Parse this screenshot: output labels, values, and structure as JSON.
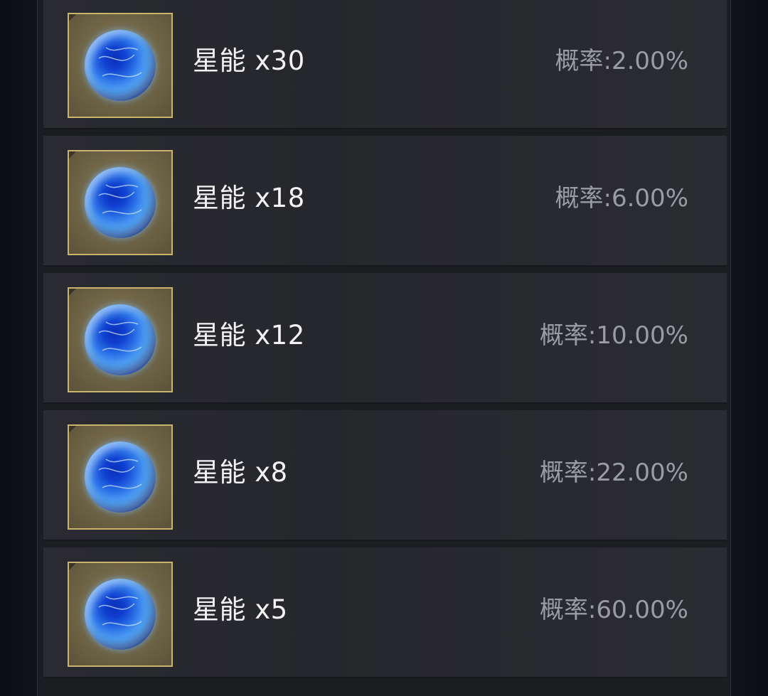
{
  "rewards": [
    {
      "name": "星能 x30",
      "probability": "概率:2.00%",
      "icon": "star-energy-orb-icon"
    },
    {
      "name": "星能 x18",
      "probability": "概率:6.00%",
      "icon": "star-energy-orb-icon"
    },
    {
      "name": "星能 x12",
      "probability": "概率:10.00%",
      "icon": "star-energy-orb-icon"
    },
    {
      "name": "星能 x8",
      "probability": "概率:22.00%",
      "icon": "star-energy-orb-icon"
    },
    {
      "name": "星能 x5",
      "probability": "概率:60.00%",
      "icon": "star-energy-orb-icon"
    }
  ],
  "colors": {
    "row_background": "#2a2b30",
    "icon_border": "#c9b46e",
    "name_text": "#f3f3f3",
    "probability_text": "#9a9ca3",
    "orb_blue": "#2a6fe6"
  }
}
